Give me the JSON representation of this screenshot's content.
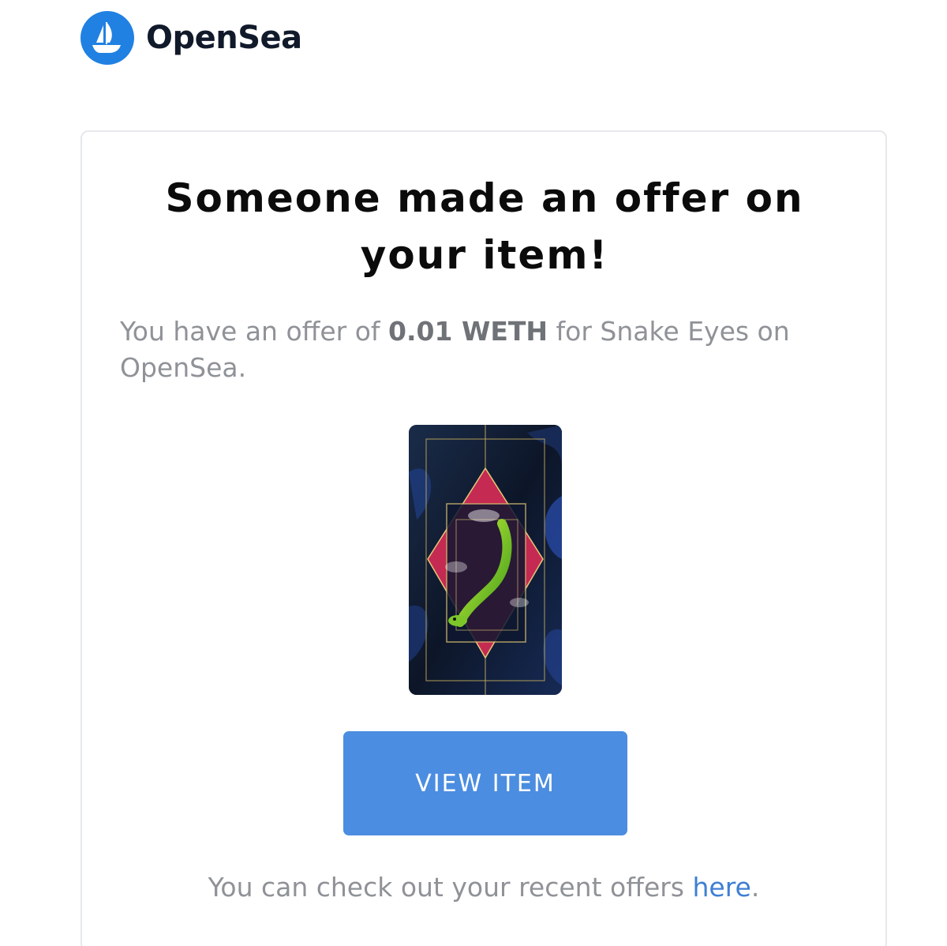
{
  "brand": {
    "name": "OpenSea",
    "logo_icon": "sailboat-logo-icon",
    "color": "#2081e2"
  },
  "email": {
    "headline": "Someone made an offer on your item!",
    "offer": {
      "prefix": "You have an offer of ",
      "amount": "0.01 WETH",
      "middle": " for Snake Eyes on",
      "suffix": "OpenSea."
    },
    "item_image_icon": "snake-eyes-nft-image",
    "view_button_label": "VIEW ITEM",
    "button_color": "#4b8de0",
    "footer": {
      "prefix": "You can check out your recent offers ",
      "link_text": "here",
      "suffix": "."
    }
  }
}
